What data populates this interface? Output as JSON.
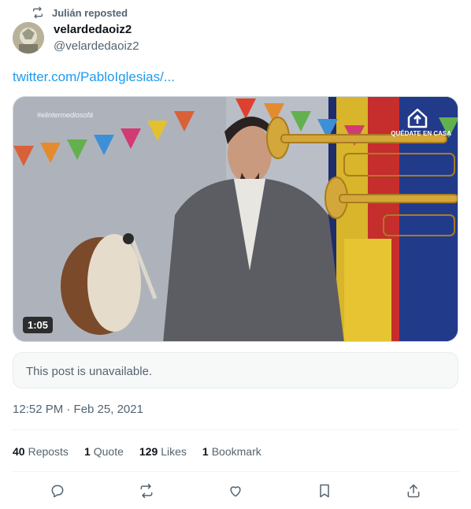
{
  "repost": {
    "label": "Julián reposted",
    "icon": "repost-icon"
  },
  "author": {
    "name": "velardedaoiz2",
    "handle": "@velardedaoiz2",
    "avatar_icon": "avatar"
  },
  "tweet": {
    "link_text": "twitter.com/PabloIglesias/..."
  },
  "media": {
    "duration": "1:05",
    "channel_tag": "#elintermediosofá",
    "overlay_text": "QUÉDATE EN CASA"
  },
  "quoted": {
    "message": "This post is unavailable."
  },
  "meta": {
    "timestamp": "12:52 PM · Feb 25, 2021"
  },
  "stats": {
    "reposts_count": "40",
    "reposts_label": "Reposts",
    "quotes_count": "1",
    "quotes_label": "Quote",
    "likes_count": "129",
    "likes_label": "Likes",
    "bookmarks_count": "1",
    "bookmarks_label": "Bookmark"
  },
  "actions": [
    "reply-icon",
    "repost-icon",
    "like-icon",
    "bookmark-icon",
    "share-icon"
  ],
  "colors": {
    "link": "#1d9bf0",
    "secondary_text": "#536471",
    "primary_text": "#0f1419"
  }
}
